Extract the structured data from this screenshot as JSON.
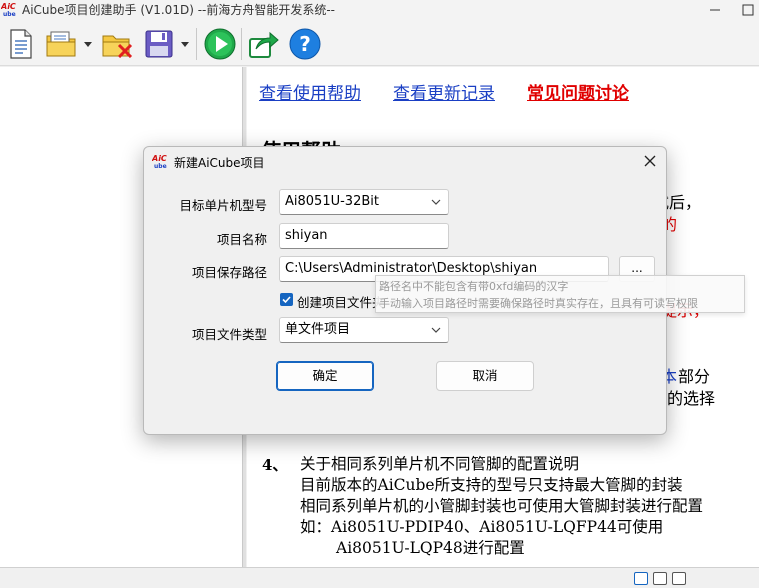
{
  "window": {
    "title": "AiCube项目创建助手 (V1.01D) --前海方舟智能开发系统--",
    "logo_text": "AiCube"
  },
  "toolbar": {
    "buttons": [
      {
        "icon": "new-document-icon"
      },
      {
        "icon": "open-folder-icon"
      },
      {
        "icon": "close-folder-icon"
      },
      {
        "icon": "save-icon"
      },
      {
        "icon": "run-icon"
      },
      {
        "icon": "export-icon"
      },
      {
        "icon": "help-icon"
      }
    ]
  },
  "content": {
    "links": {
      "help": "查看使用帮助",
      "changelog": "查看更新记录",
      "faq": "常见问题讨论"
    },
    "heading": "使用帮助",
    "fragments": {
      "f1": "式后，",
      "f2": "的",
      "f3": "提示，",
      "f4": "本",
      "f5": "部分",
      "f6": "的选择"
    },
    "section4": {
      "num": "4、",
      "title": "关于相同系列单片机不同管脚的配置说明",
      "line1": "目前版本的AiCube所支持的型号只支持最大管脚的封装",
      "line2": "相同系列单片机的小管脚封装也可使用大管脚封装进行配置",
      "line3": "如：Ai8051U-PDIP40、Ai8051U-LQFP44可使用",
      "line4": "Ai8051U-LQP48进行配置"
    }
  },
  "dialog": {
    "title": "新建AiCube项目",
    "mcu_label": "目标单片机型号",
    "mcu_value": "Ai8051U-32Bit",
    "name_label": "项目名称",
    "name_value": "shiyan",
    "path_label": "项目保存路径",
    "path_value": "C:\\Users\\Administrator\\Desktop\\shiyan",
    "browse_label": "...",
    "create_folder_label": "创建项目文件夹",
    "create_folder_checked": true,
    "filetype_label": "项目文件类型",
    "filetype_value": "单文件项目",
    "ok_label": "确定",
    "cancel_label": "取消"
  },
  "tooltip": {
    "line1": "路径名中不能包含有带0xfd编码的汉字",
    "line2": "手动输入项目路径时需要确保路径时真实存在，且具有可读写权限"
  },
  "colors": {
    "link_blue": "#1a3fc4",
    "link_red": "#e00000",
    "accent": "#1565c0"
  }
}
